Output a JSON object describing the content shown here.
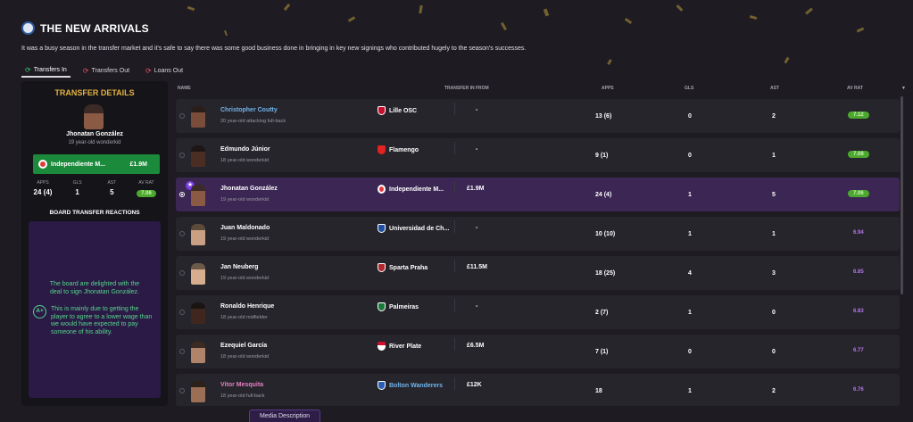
{
  "colors": {
    "accent_gold": "#e4b342",
    "selected_row": "#3b2654",
    "club_green": "#1c8a3b",
    "rating_green": "#4ca82e",
    "rating_purple": "#b376e8"
  },
  "header": {
    "title": "THE NEW ARRIVALS",
    "icon": "club-crest-icon",
    "intro": "It was a busy season in the transfer market and it's safe to say there was some good business done in bringing in key new signings who contributed hugely to the season's successes."
  },
  "tabs": [
    {
      "label": "Transfers In",
      "icon": "transfer-in-icon"
    },
    {
      "label": "Transfers Out",
      "icon": "transfer-out-icon"
    },
    {
      "label": "Loans Out",
      "icon": "loan-out-icon"
    }
  ],
  "details": {
    "title": "TRANSFER DETAILS",
    "name": "Jhonatan González",
    "desc": "19 year-old wonderkid",
    "club": "Independiente M...",
    "fee": "£1.9M",
    "stat_labels": [
      "APPS",
      "GLS",
      "AST",
      "AV RAT"
    ],
    "stat_values": [
      "24 (4)",
      "1",
      "5",
      "7.06"
    ],
    "board_title": "BOARD TRANSFER REACTIONS",
    "reaction_main": "The board are delighted with the deal to sign Jhonatan González.",
    "grade": "A+",
    "reaction_detail": "This is mainly due to getting the player to agree to a lower wage than we would have expected to pay someone of his ability."
  },
  "columns": {
    "name": "NAME",
    "from": "TRANSFER IN FROM",
    "apps": "APPS",
    "gls": "GLS",
    "ast": "AST",
    "avrat": "AV RAT"
  },
  "rows": [
    {
      "name": "Christopher Coutty",
      "desc": "20 year-old attacking full-back",
      "club": "Lille OSC",
      "fee": "-",
      "apps": "13 (6)",
      "gls": "0",
      "ast": "2",
      "rating": "7.12"
    },
    {
      "name": "Edmundo Júnior",
      "desc": "18 year-old wonderkid",
      "club": "Flamengo",
      "fee": "-",
      "apps": "9 (1)",
      "gls": "0",
      "ast": "1",
      "rating": "7.08"
    },
    {
      "name": "Jhonatan González",
      "desc": "19 year-old wonderkid",
      "club": "Independiente M...",
      "fee": "£1.9M",
      "apps": "24 (4)",
      "gls": "1",
      "ast": "5",
      "rating": "7.06"
    },
    {
      "name": "Juan Maldonado",
      "desc": "19 year-old wonderkid",
      "club": "Universidad de Ch...",
      "fee": "-",
      "apps": "10 (10)",
      "gls": "1",
      "ast": "1",
      "rating": "6.94"
    },
    {
      "name": "Jan Neuberg",
      "desc": "19 year-old wonderkid",
      "club": "Sparta Praha",
      "fee": "£11.5M",
      "apps": "18 (25)",
      "gls": "4",
      "ast": "3",
      "rating": "6.85"
    },
    {
      "name": "Ronaldo Henrique",
      "desc": "18 year-old midfielder",
      "club": "Palmeiras",
      "fee": "-",
      "apps": "2 (7)",
      "gls": "1",
      "ast": "0",
      "rating": "6.83"
    },
    {
      "name": "Ezequiel García",
      "desc": "18 year-old wonderkid",
      "club": "River Plate",
      "fee": "£6.5M",
      "apps": "7 (1)",
      "gls": "0",
      "ast": "0",
      "rating": "6.77"
    },
    {
      "name": "Vitor Mesquita",
      "desc": "18 year-old full-back",
      "club": "Bolton Wanderers",
      "fee": "£12K",
      "apps": "18",
      "gls": "1",
      "ast": "2",
      "rating": "6.76"
    }
  ],
  "media_button": "Media Description"
}
